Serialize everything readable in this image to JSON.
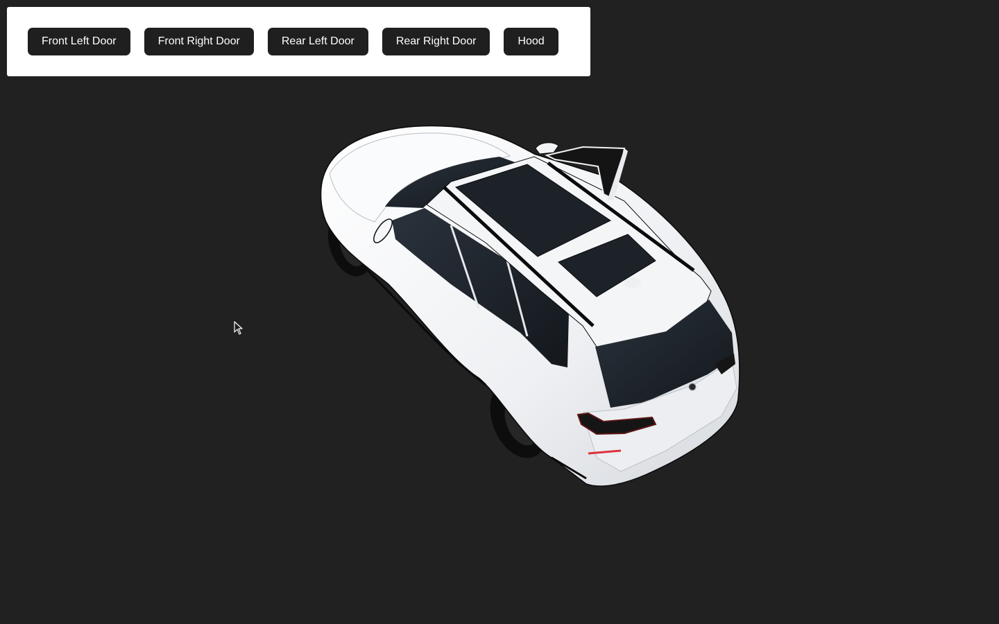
{
  "toolbar": {
    "buttons": [
      {
        "label": "Front Left Door"
      },
      {
        "label": "Front Right Door"
      },
      {
        "label": "Rear Left Door"
      },
      {
        "label": "Rear Right Door"
      },
      {
        "label": "Hood"
      }
    ]
  },
  "scene": {
    "background_color": "#212121",
    "model_color": "#f2f3f5",
    "glass_color": "#1c2128",
    "open_parts": [
      "Rear Right Door"
    ]
  },
  "icons": {
    "cursor": "arrow-cursor-icon"
  }
}
